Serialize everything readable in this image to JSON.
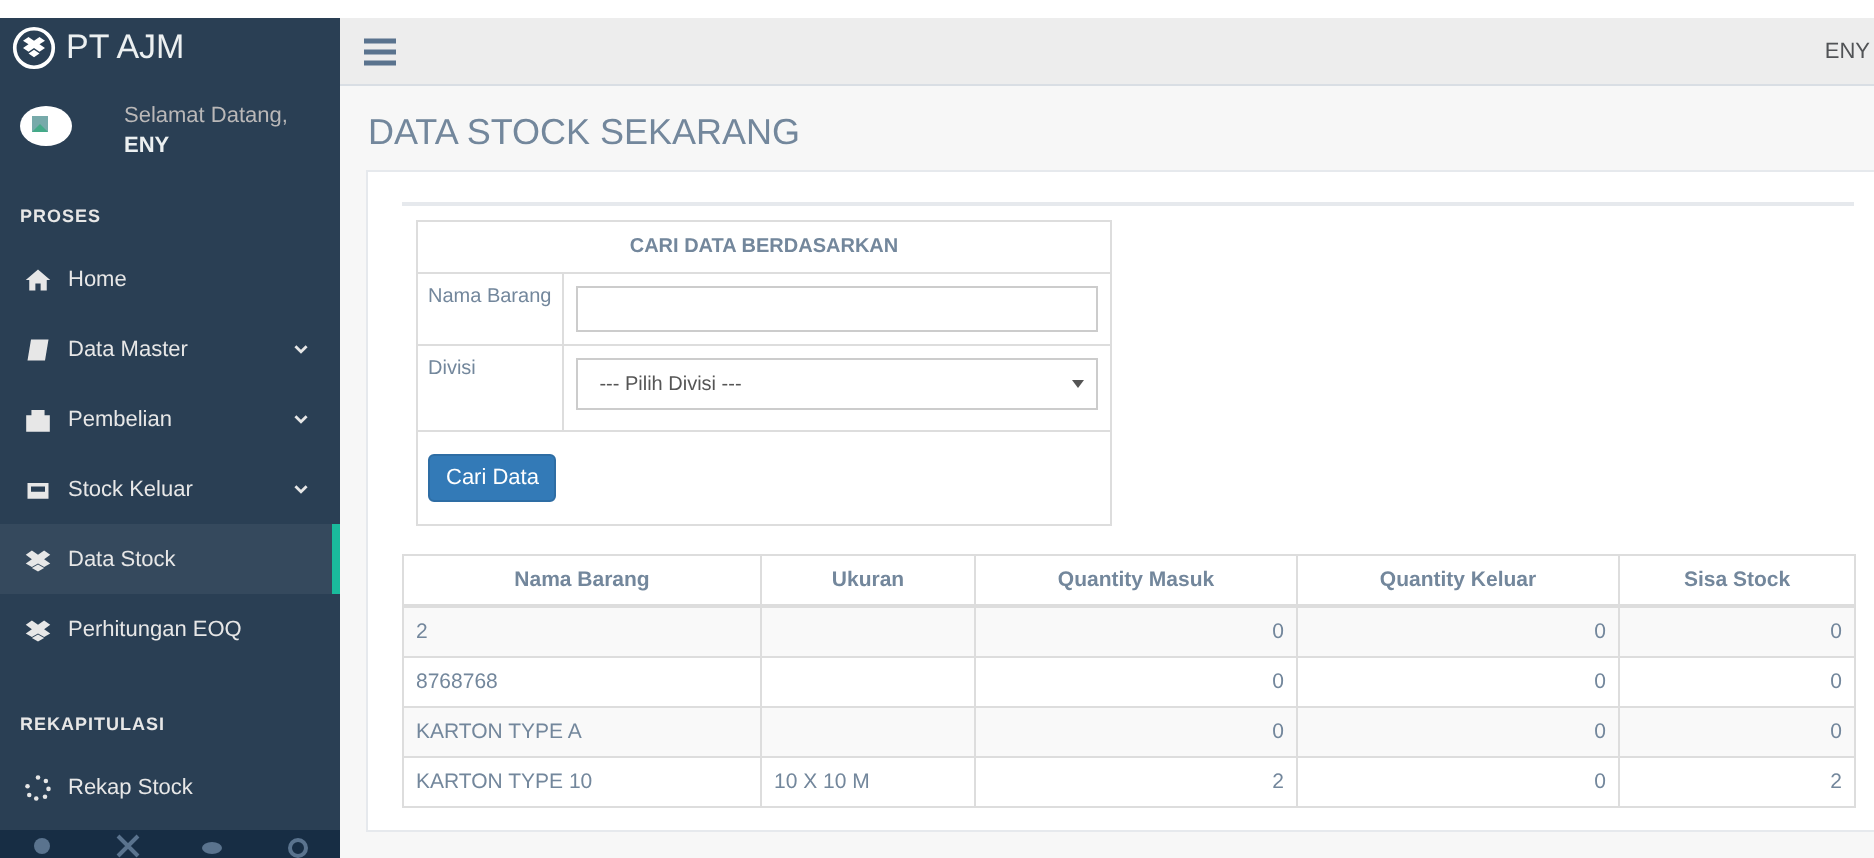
{
  "brand": "PT AJM",
  "profile": {
    "greeting": "Selamat Datang,",
    "name": "ENY"
  },
  "sidebar": {
    "sections": [
      {
        "title": "PROSES",
        "items": [
          {
            "label": "Home",
            "expandable": false,
            "selected": false
          },
          {
            "label": "Data Master",
            "expandable": true,
            "selected": false
          },
          {
            "label": "Pembelian",
            "expandable": true,
            "selected": false
          },
          {
            "label": "Stock Keluar",
            "expandable": true,
            "selected": false
          },
          {
            "label": "Data Stock",
            "expandable": false,
            "selected": true
          },
          {
            "label": "Perhitungan EOQ",
            "expandable": false,
            "selected": false
          }
        ]
      },
      {
        "title": "REKAPITULASI",
        "items": [
          {
            "label": "Rekap Stock",
            "expandable": false,
            "selected": false
          }
        ]
      }
    ]
  },
  "top_nav": {
    "user": "ENY"
  },
  "page_title": "DATA STOCK SEKARANG",
  "search_form": {
    "title": "CARI DATA BERDASARKAN",
    "fields": [
      {
        "label": "Nama Barang",
        "kind": "text"
      },
      {
        "label": "Divisi",
        "kind": "select",
        "value": "--- Pilih Divisi ---"
      }
    ],
    "button": "Cari Data"
  },
  "table": {
    "columns": [
      "Nama Barang",
      "Ukuran",
      "Quantity Masuk",
      "Quantity Keluar",
      "Sisa Stock"
    ],
    "rows": [
      [
        "2",
        "",
        "0",
        "0",
        "0"
      ],
      [
        "8768768",
        "",
        "0",
        "0",
        "0"
      ],
      [
        "KARTON TYPE A",
        "",
        "0",
        "0",
        "0"
      ],
      [
        "KARTON TYPE 10",
        "10 X 10 M",
        "2",
        "0",
        "2"
      ]
    ]
  }
}
